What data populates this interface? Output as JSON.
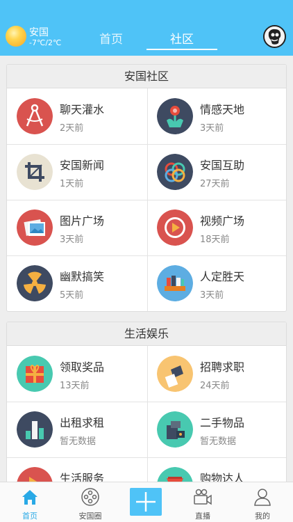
{
  "header": {
    "city": "安国",
    "temperature": "-7℃/2℃",
    "tabs": [
      {
        "label": "首页",
        "active": false
      },
      {
        "label": "社区",
        "active": true
      }
    ],
    "accent_color": "#4fc3f7"
  },
  "sections": [
    {
      "title": "安国社区",
      "items": [
        {
          "name": "聊天灌水",
          "time": "2天前",
          "icon": "compass-icon",
          "color": "#d9534f"
        },
        {
          "name": "情感天地",
          "time": "3天前",
          "icon": "flower-icon",
          "color": "#3e4a61"
        },
        {
          "name": "安国新闻",
          "time": "1天前",
          "icon": "crop-icon",
          "color": "#e8e2d2"
        },
        {
          "name": "安国互助",
          "time": "27天前",
          "icon": "rings-icon",
          "color": "#3e4a61"
        },
        {
          "name": "图片广场",
          "time": "3天前",
          "icon": "photos-icon",
          "color": "#d9534f"
        },
        {
          "name": "视频广场",
          "time": "18天前",
          "icon": "play-icon",
          "color": "#d9534f"
        },
        {
          "name": "幽默搞笑",
          "time": "5天前",
          "icon": "radiation-icon",
          "color": "#3e4a61"
        },
        {
          "name": "人定胜天",
          "time": "3天前",
          "icon": "books-icon",
          "color": "#5dade2"
        }
      ]
    },
    {
      "title": "生活娱乐",
      "items": [
        {
          "name": "领取奖品",
          "time": "13天前",
          "icon": "gift-icon",
          "color": "#48c9b0"
        },
        {
          "name": "招聘求职",
          "time": "24天前",
          "icon": "badge-icon",
          "color": "#f8c471"
        },
        {
          "name": "出租求租",
          "time": "暂无数据",
          "icon": "chart-icon",
          "color": "#3e4a61"
        },
        {
          "name": "二手物品",
          "time": "暂无数据",
          "icon": "printer-icon",
          "color": "#48c9b0"
        },
        {
          "name": "生活服务",
          "time": "",
          "icon": "service-icon",
          "color": "#d9534f"
        },
        {
          "name": "购物达人",
          "time": "",
          "icon": "cart-icon",
          "color": "#48c9b0"
        }
      ]
    }
  ],
  "nav": [
    {
      "label": "首页",
      "icon": "home-icon",
      "active": true
    },
    {
      "label": "安国圈",
      "icon": "circle-group-icon",
      "active": false
    },
    {
      "label": "",
      "icon": "plus-icon",
      "active": false
    },
    {
      "label": "直播",
      "icon": "video-camera-icon",
      "active": false
    },
    {
      "label": "我的",
      "icon": "user-icon",
      "active": false
    }
  ]
}
